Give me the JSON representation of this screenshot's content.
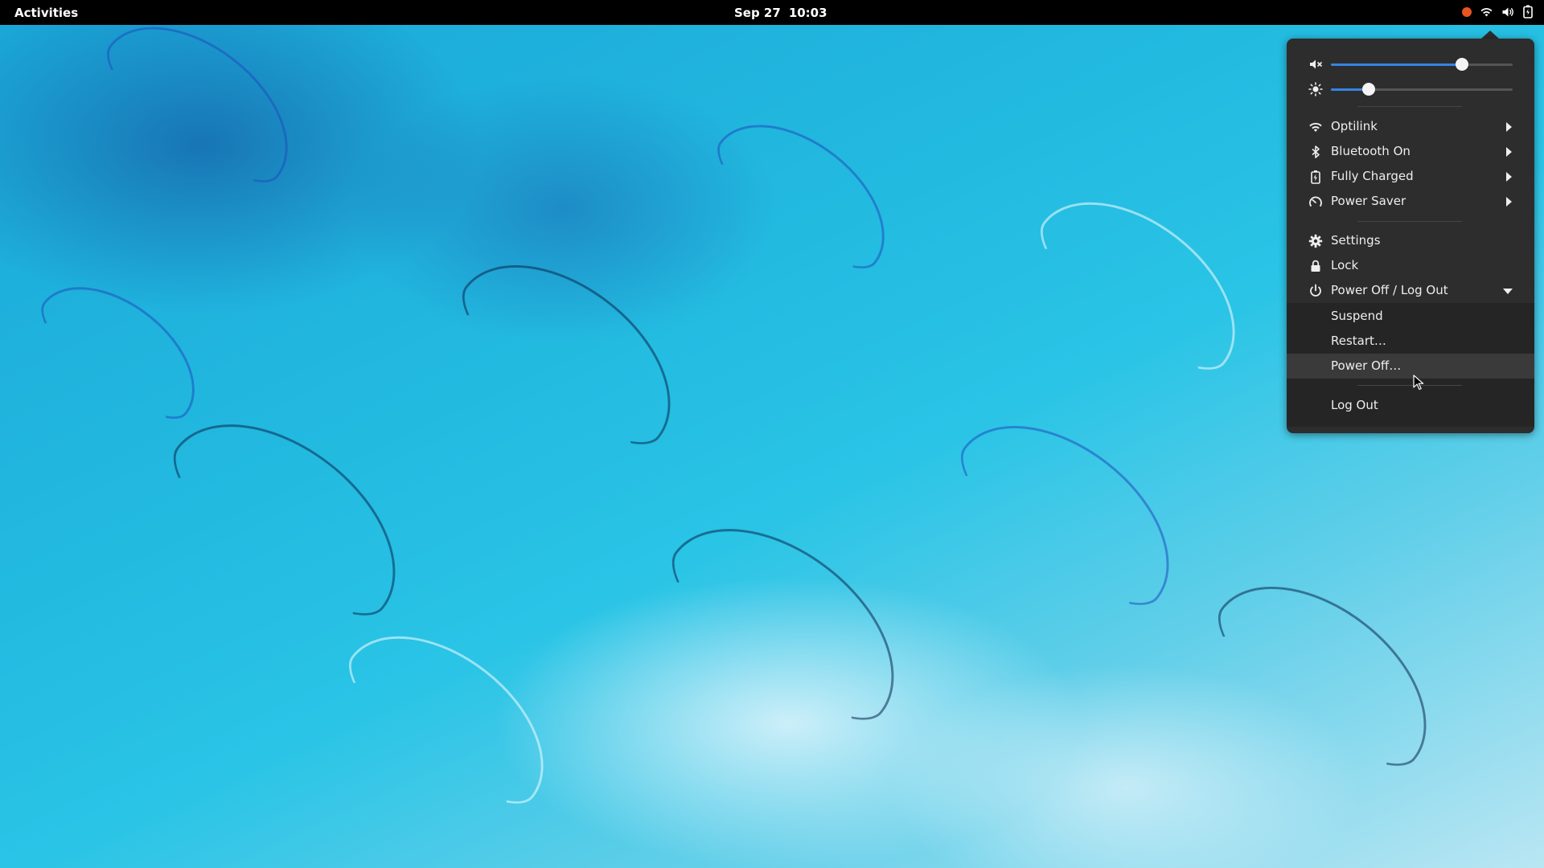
{
  "topbar": {
    "activities_label": "Activities",
    "date": "Sep 27",
    "time": "10:03",
    "tray_icons": [
      "notification-dot",
      "wifi-icon",
      "volume-icon",
      "battery-icon"
    ]
  },
  "quick_settings": {
    "volume": {
      "icon": "volume-muted-icon",
      "level": 0.72
    },
    "brightness": {
      "icon": "brightness-icon",
      "level": 0.21
    },
    "items": [
      {
        "id": "wifi",
        "icon": "wifi-icon",
        "label": "Optilink",
        "has_submenu": true
      },
      {
        "id": "bluetooth",
        "icon": "bluetooth-icon",
        "label": "Bluetooth On",
        "has_submenu": true
      },
      {
        "id": "battery",
        "icon": "battery-icon",
        "label": "Fully Charged",
        "has_submenu": true
      },
      {
        "id": "power-mode",
        "icon": "power-saver-icon",
        "label": "Power Saver",
        "has_submenu": true
      }
    ],
    "settings_label": "Settings",
    "lock_label": "Lock",
    "power_menu": {
      "label": "Power Off / Log Out",
      "expanded": true,
      "suspend_label": "Suspend",
      "restart_label": "Restart…",
      "poweroff_label": "Power Off…",
      "logout_label": "Log Out",
      "hovered": "Power Off…"
    }
  },
  "colors": {
    "topbar_bg": "#000000",
    "menu_bg": "#2d2d2d",
    "accent": "#3584e4",
    "notification_dot": "#e95420"
  }
}
